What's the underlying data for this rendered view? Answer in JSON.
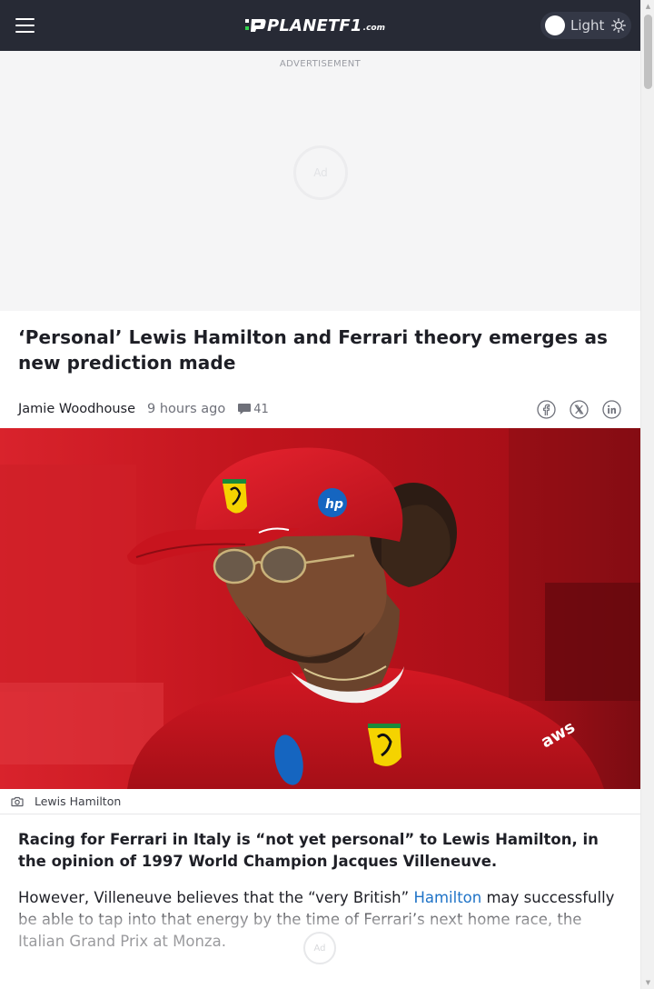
{
  "header": {
    "logo_text": "PLANETF1",
    "logo_domain": ".com",
    "theme_label": "Light"
  },
  "ad": {
    "label": "ADVERTISEMENT",
    "placeholder": "Ad"
  },
  "article": {
    "headline": "‘Personal’ Lewis Hamilton and Ferrari theory emerges as new prediction made",
    "author": "Jamie Woodhouse",
    "time": "9 hours ago",
    "comment_count": "41",
    "image_caption": "Lewis Hamilton",
    "lede": "Racing for Ferrari in Italy is “not yet personal” to Lewis Hamilton, in the opinion of 1997 World Champion Jacques Villeneuve.",
    "para_before_link": "However, Villeneuve believes that the “very British” ",
    "para_link": "Hamilton",
    "para_after_link": " may successfully be able to tap into that energy by the time of Ferrari’s next home race, the Italian Grand Prix at Monza.",
    "inline_ad": "Ad"
  },
  "share_icons": [
    "facebook-icon",
    "x-icon",
    "linkedin-icon"
  ],
  "colors": {
    "header_bg": "#272a35",
    "link": "#1f73c7",
    "ferrari_red": "#c8141e"
  }
}
